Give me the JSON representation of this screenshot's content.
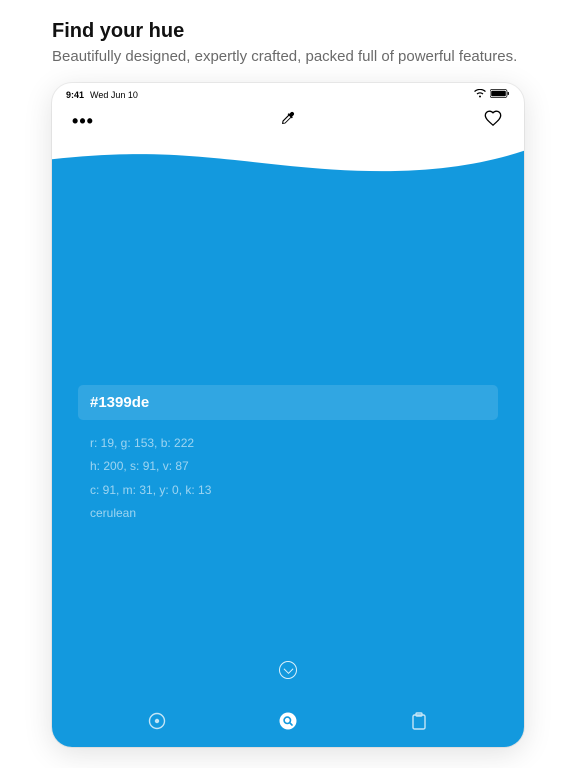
{
  "header": {
    "title": "Find your hue",
    "subtitle": "Beautifully designed, expertly crafted, packed full of powerful features."
  },
  "statusBar": {
    "time": "9:41",
    "date": "Wed Jun 10"
  },
  "color": {
    "hex": "#1399de",
    "rgb": "r: 19, g: 153, b: 222",
    "hsv": "h: 200, s: 91, v: 87",
    "cmyk": "c: 91, m: 31, y: 0, k: 13",
    "name": "cerulean",
    "swatch": "#1399de"
  }
}
